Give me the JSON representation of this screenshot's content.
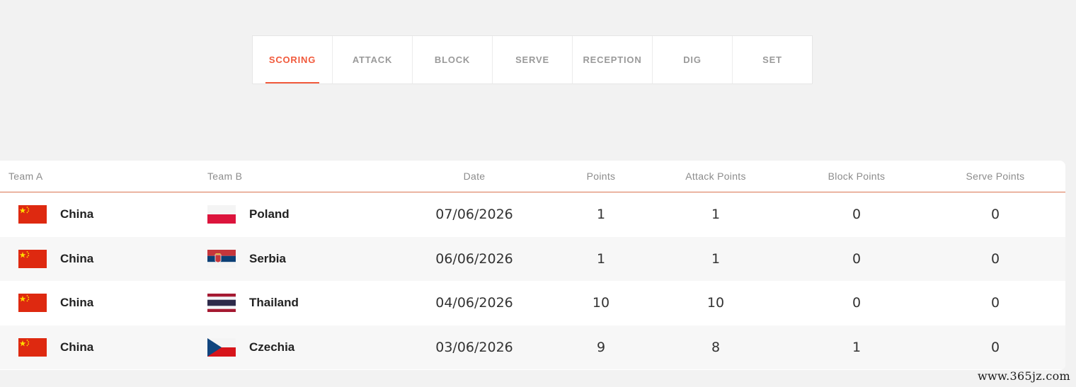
{
  "tabs": [
    {
      "label": "SCORING",
      "active": true
    },
    {
      "label": "ATTACK",
      "active": false
    },
    {
      "label": "BLOCK",
      "active": false
    },
    {
      "label": "SERVE",
      "active": false
    },
    {
      "label": "RECEPTION",
      "active": false
    },
    {
      "label": "DIG",
      "active": false
    },
    {
      "label": "SET",
      "active": false
    }
  ],
  "table": {
    "headers": {
      "team_a": "Team A",
      "team_b": "Team B",
      "date": "Date",
      "points": "Points",
      "attack_points": "Attack Points",
      "block_points": "Block Points",
      "serve_points": "Serve Points"
    },
    "rows": [
      {
        "team_a": "China",
        "team_a_flag": "china-flag-icon",
        "team_b": "Poland",
        "team_b_flag": "poland-flag-icon",
        "date": "07/06/2026",
        "points": "1",
        "attack_points": "1",
        "block_points": "0",
        "serve_points": "0"
      },
      {
        "team_a": "China",
        "team_a_flag": "china-flag-icon",
        "team_b": "Serbia",
        "team_b_flag": "serbia-flag-icon",
        "date": "06/06/2026",
        "points": "1",
        "attack_points": "1",
        "block_points": "0",
        "serve_points": "0"
      },
      {
        "team_a": "China",
        "team_a_flag": "china-flag-icon",
        "team_b": "Thailand",
        "team_b_flag": "thailand-flag-icon",
        "date": "04/06/2026",
        "points": "10",
        "attack_points": "10",
        "block_points": "0",
        "serve_points": "0"
      },
      {
        "team_a": "China",
        "team_a_flag": "china-flag-icon",
        "team_b": "Czechia",
        "team_b_flag": "czechia-flag-icon",
        "date": "03/06/2026",
        "points": "9",
        "attack_points": "8",
        "block_points": "1",
        "serve_points": "0"
      }
    ]
  },
  "watermark": "www.365jz.com",
  "colors": {
    "accent": "#f15a3c",
    "header_text": "#8c8c8c",
    "row_alt_bg": "#f7f7f7",
    "page_bg": "#f2f2f2"
  }
}
